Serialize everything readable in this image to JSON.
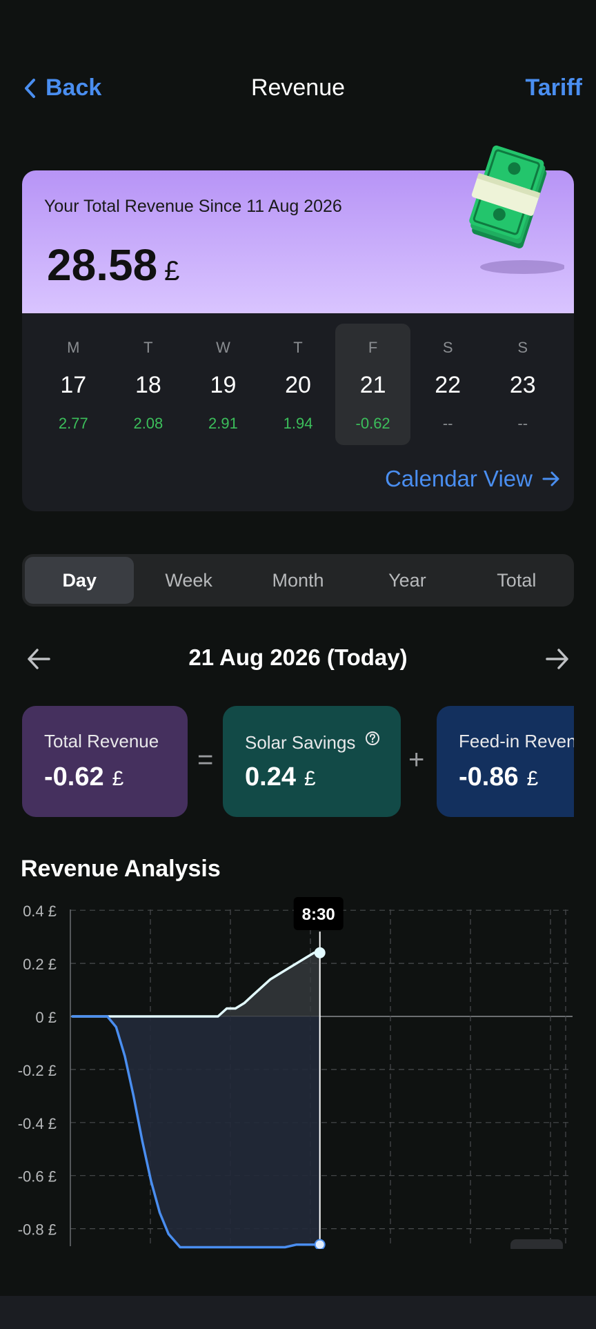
{
  "nav": {
    "back_label": "Back",
    "title": "Revenue",
    "tariff_label": "Tariff"
  },
  "revenue": {
    "since": "Your Total Revenue Since 11 Aug 2026",
    "amount": "28.58",
    "currency": "£"
  },
  "week": [
    {
      "letter": "M",
      "num": "17",
      "value": "2.77",
      "active": false
    },
    {
      "letter": "T",
      "num": "18",
      "value": "2.08",
      "active": false
    },
    {
      "letter": "W",
      "num": "19",
      "value": "2.91",
      "active": false
    },
    {
      "letter": "T",
      "num": "20",
      "value": "1.94",
      "active": false
    },
    {
      "letter": "F",
      "num": "21",
      "value": "-0.62",
      "active": true
    },
    {
      "letter": "S",
      "num": "22",
      "value": "--",
      "active": false
    },
    {
      "letter": "S",
      "num": "23",
      "value": "--",
      "active": false
    }
  ],
  "calendar_link": "Calendar View",
  "tabs": [
    {
      "label": "Day",
      "active": true
    },
    {
      "label": "Week",
      "active": false
    },
    {
      "label": "Month",
      "active": false
    },
    {
      "label": "Year",
      "active": false
    },
    {
      "label": "Total",
      "active": false
    }
  ],
  "date_label": "21 Aug 2026 (Today)",
  "summary": {
    "total": {
      "title": "Total Revenue",
      "value": "-0.62",
      "currency": "£"
    },
    "equals": "=",
    "solar": {
      "title": "Solar Savings",
      "value": "0.24",
      "currency": "£"
    },
    "plus": "+",
    "feedin": {
      "title": "Feed-in Revenue",
      "value": "-0.86",
      "currency": "£"
    }
  },
  "colors": {
    "accent": "#4a8ef0",
    "positive": "#3cbf5b",
    "total_card": "#45305e",
    "solar_card": "#124a47",
    "feedin_card": "#13305e",
    "solar_line": "#e3fbff",
    "feedin_line": "#4a8ef0"
  },
  "chart_title": "Revenue Analysis",
  "chart_data": {
    "type": "line",
    "ylim": [
      -0.87,
      0.4
    ],
    "y_ticks": [
      "0.4 £",
      "0.2 £",
      "0 £",
      "-0.2 £",
      "-0.4 £",
      "-0.6 £",
      "-0.8 £"
    ],
    "y_tick_values": [
      0.4,
      0.2,
      0,
      -0.2,
      -0.4,
      -0.6,
      -0.8
    ],
    "x_hours": [
      0,
      24
    ],
    "tooltip": {
      "label": "8:30",
      "hour": 8.5
    },
    "series": [
      {
        "color": "#e3fbff",
        "points": [
          [
            0,
            0
          ],
          [
            0.5,
            0
          ],
          [
            1,
            0
          ],
          [
            1.5,
            0
          ],
          [
            2,
            0
          ],
          [
            2.5,
            0
          ],
          [
            3,
            0
          ],
          [
            3.5,
            0
          ],
          [
            4,
            0
          ],
          [
            4.5,
            0
          ],
          [
            5,
            0
          ],
          [
            5.3,
            0.03
          ],
          [
            5.6,
            0.03
          ],
          [
            5.9,
            0.05
          ],
          [
            6.2,
            0.08
          ],
          [
            6.5,
            0.11
          ],
          [
            6.8,
            0.14
          ],
          [
            7.1,
            0.16
          ],
          [
            7.4,
            0.18
          ],
          [
            7.7,
            0.2
          ],
          [
            8,
            0.22
          ],
          [
            8.3,
            0.24
          ],
          [
            8.5,
            0.24
          ]
        ]
      },
      {
        "color": "#4a8ef0",
        "points": [
          [
            0,
            0
          ],
          [
            0.8,
            0
          ],
          [
            1.2,
            0
          ],
          [
            1.5,
            -0.04
          ],
          [
            1.8,
            -0.15
          ],
          [
            2.1,
            -0.3
          ],
          [
            2.4,
            -0.47
          ],
          [
            2.7,
            -0.62
          ],
          [
            3,
            -0.74
          ],
          [
            3.3,
            -0.82
          ],
          [
            3.7,
            -0.87
          ],
          [
            4.5,
            -0.87
          ],
          [
            5.5,
            -0.87
          ],
          [
            6.5,
            -0.87
          ],
          [
            7.3,
            -0.87
          ],
          [
            7.7,
            -0.86
          ],
          [
            8.1,
            -0.86
          ],
          [
            8.5,
            -0.86
          ]
        ]
      }
    ]
  }
}
